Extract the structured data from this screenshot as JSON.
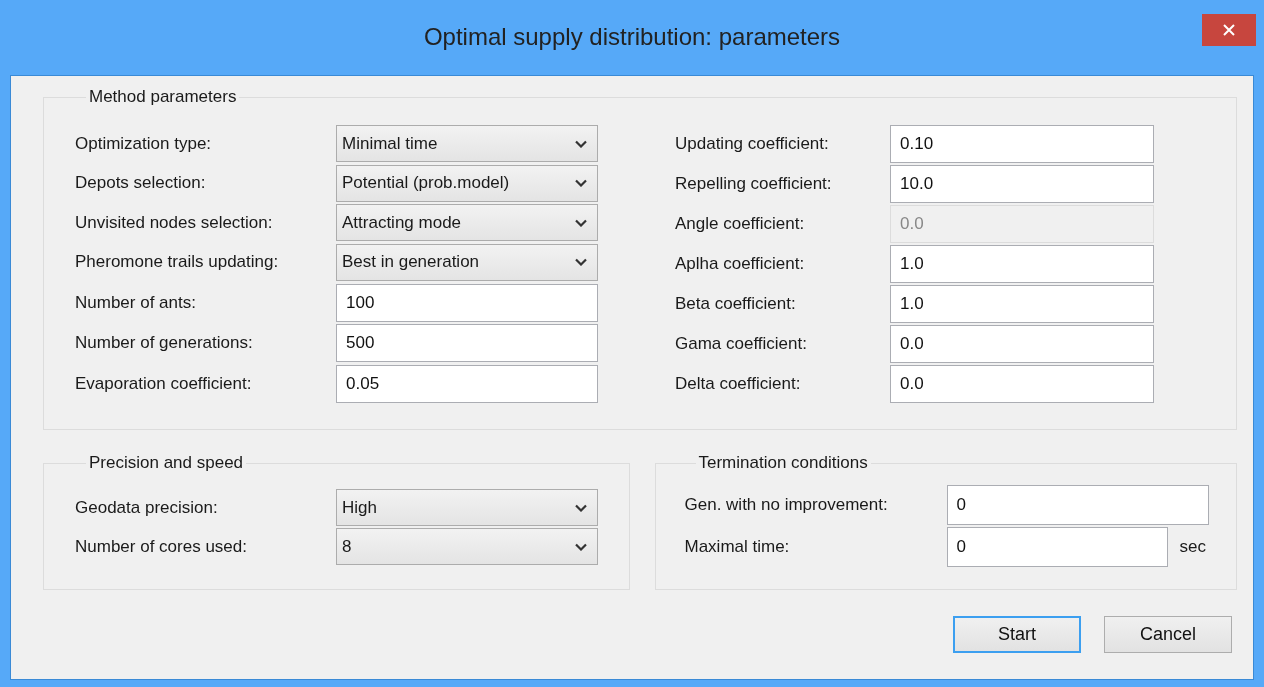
{
  "window": {
    "title": "Optimal supply distribution: parameters"
  },
  "groups": [
    {
      "title": "Method parameters",
      "columns": [
        [
          {
            "label": "Optimization type:",
            "kind": "combo",
            "value": "Minimal time",
            "disabled": false
          },
          {
            "label": "Depots selection:",
            "kind": "combo",
            "value": "Potential (prob.model)",
            "disabled": false
          },
          {
            "label": "Unvisited nodes selection:",
            "kind": "combo",
            "value": "Attracting mode",
            "disabled": false
          },
          {
            "label": "Pheromone trails updating:",
            "kind": "combo",
            "value": "Best in generation",
            "disabled": false
          },
          {
            "label": "Number of ants:",
            "kind": "text",
            "value": "100",
            "disabled": false
          },
          {
            "label": "Number of generations:",
            "kind": "text",
            "value": "500",
            "disabled": false
          },
          {
            "label": "Evaporation coefficient:",
            "kind": "text",
            "value": "0.05",
            "disabled": false
          }
        ],
        [
          {
            "label": "Updating coefficient:",
            "kind": "text",
            "value": "0.10",
            "disabled": false
          },
          {
            "label": "Repelling coefficient:",
            "kind": "text",
            "value": "10.0",
            "disabled": false
          },
          {
            "label": "Angle coefficient:",
            "kind": "text",
            "value": "0.0",
            "disabled": true
          },
          {
            "label": "Aplha coefficient:",
            "kind": "text",
            "value": "1.0",
            "disabled": false
          },
          {
            "label": "Beta coefficient:",
            "kind": "text",
            "value": "1.0",
            "disabled": false
          },
          {
            "label": "Gama coefficient:",
            "kind": "text",
            "value": "0.0",
            "disabled": false
          },
          {
            "label": "Delta coefficient:",
            "kind": "text",
            "value": "0.0",
            "disabled": false
          }
        ]
      ]
    },
    {
      "title": "Precision and speed",
      "columns": [
        [
          {
            "label": "Geodata precision:",
            "kind": "combo",
            "value": "High",
            "disabled": false
          },
          {
            "label": "Number of cores used:",
            "kind": "combo",
            "value": "8",
            "disabled": false
          }
        ]
      ]
    },
    {
      "title": "Termination conditions",
      "columns": [
        [
          {
            "label": "Gen. with no improvement:",
            "kind": "text",
            "value": "0",
            "disabled": false
          },
          {
            "label": "Maximal time:",
            "kind": "text",
            "value": "0",
            "disabled": false,
            "unit": "sec"
          }
        ]
      ]
    }
  ],
  "buttons": [
    {
      "label": "Start",
      "default": true
    },
    {
      "label": "Cancel",
      "default": false
    }
  ]
}
